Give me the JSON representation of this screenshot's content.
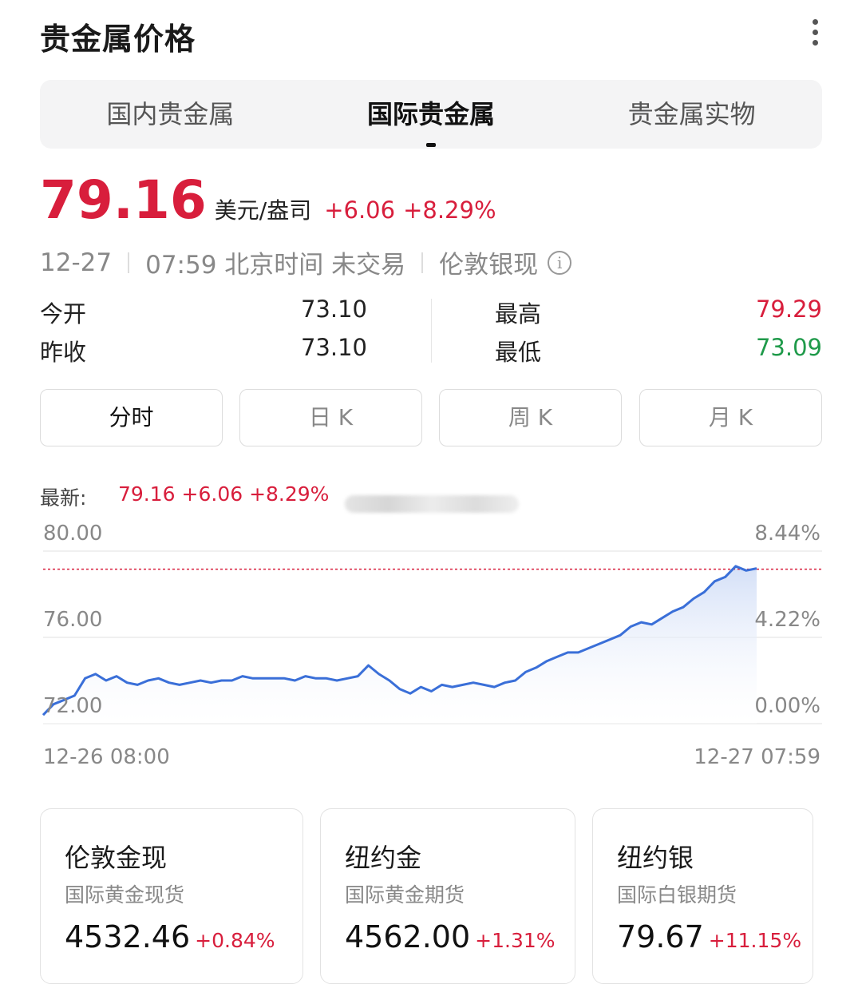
{
  "header": {
    "title": "贵金属价格",
    "more_icon": "more-vertical-icon"
  },
  "tabs": [
    {
      "label": "国内贵金属",
      "active": false
    },
    {
      "label": "国际贵金属",
      "active": true
    },
    {
      "label": "贵金属实物",
      "active": false
    }
  ],
  "quote": {
    "price": "79.16",
    "unit": "美元/盎司",
    "change": "+6.06",
    "change_pct": "+8.29%",
    "date": "12-27",
    "time_status": "07:59 北京时间 未交易",
    "market": "伦敦银现",
    "info_icon": "info-icon"
  },
  "stats": {
    "open_label": "今开",
    "open": "73.10",
    "prev_close_label": "昨收",
    "prev_close": "73.10",
    "high_label": "最高",
    "high": "79.29",
    "low_label": "最低",
    "low": "73.09"
  },
  "period_tabs": [
    {
      "label": "分时",
      "active": true
    },
    {
      "label": "日 K",
      "active": false
    },
    {
      "label": "周 K",
      "active": false
    },
    {
      "label": "月 K",
      "active": false
    }
  ],
  "chart_header": {
    "latest_label": "最新:",
    "latest_value": "79.16 +6.06 +8.29%"
  },
  "chart_data": {
    "type": "area",
    "title": "",
    "xlabel": "",
    "ylabel": "",
    "x_start_label": "12-26 08:00",
    "x_end_label": "12-27 07:59",
    "ylim": [
      72.0,
      80.0
    ],
    "y_ticks": [
      "80.00",
      "76.00",
      "72.00"
    ],
    "y_right_ticks": [
      "8.44%",
      "4.22%",
      "0.00%"
    ],
    "reference_value": 79.16,
    "grid": true,
    "colors": {
      "line": "#3a6fd8",
      "fill_top": "#cfdcf6",
      "reference": "#d81e3c"
    },
    "series": [
      {
        "values": [
          72.4,
          72.9,
          73.1,
          73.3,
          74.1,
          74.3,
          74.0,
          74.2,
          73.9,
          73.8,
          74.0,
          74.1,
          73.9,
          73.8,
          73.9,
          74.0,
          73.9,
          74.0,
          74.0,
          74.2,
          74.1,
          74.1,
          74.1,
          74.1,
          74.0,
          74.2,
          74.1,
          74.1,
          74.0,
          74.1,
          74.2,
          74.7,
          74.3,
          74.0,
          73.6,
          73.4,
          73.7,
          73.5,
          73.8,
          73.7,
          73.8,
          73.9,
          73.8,
          73.7,
          73.9,
          74.0,
          74.4,
          74.6,
          74.9,
          75.1,
          75.3,
          75.3,
          75.5,
          75.7,
          75.9,
          76.1,
          76.5,
          76.7,
          76.6,
          76.9,
          77.2,
          77.4,
          77.8,
          78.1,
          78.6,
          78.8,
          79.3,
          79.1,
          79.2
        ]
      }
    ]
  },
  "cards": [
    {
      "name": "伦敦金现",
      "sub": "国际黄金现货",
      "price": "4532.46",
      "change_pct": "+0.84%"
    },
    {
      "name": "纽约金",
      "sub": "国际黄金期货",
      "price": "4562.00",
      "change_pct": "+1.31%"
    },
    {
      "name": "纽约银",
      "sub": "国际白银期货",
      "price": "79.67",
      "change_pct": "+11.15%"
    }
  ]
}
